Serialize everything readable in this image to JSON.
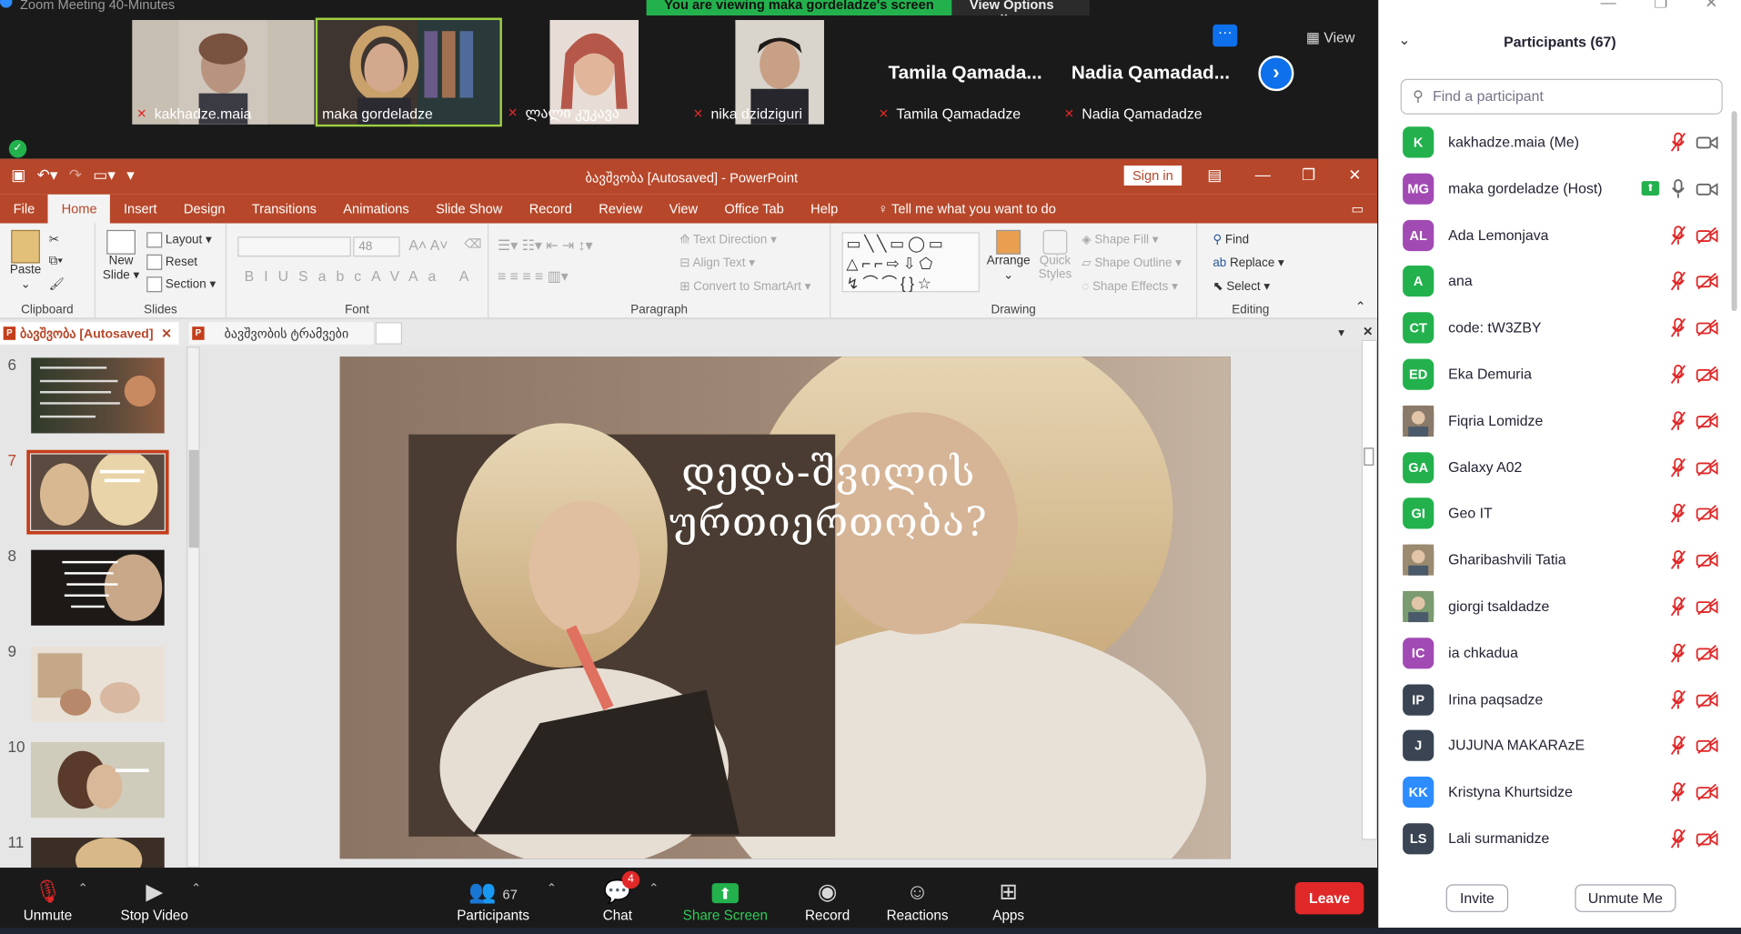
{
  "window": {
    "title": "Zoom Meeting 40-Minutes",
    "share_banner": "You are viewing maka gordeladze's screen",
    "view_options": "View Options"
  },
  "gallery": {
    "tiles": [
      {
        "name": "kakhadze.maia",
        "muted": true
      },
      {
        "name": "maka gordeladze",
        "muted": false
      },
      {
        "name": "ლალი კუკავა",
        "muted": true
      },
      {
        "name": "nika dzidziguri",
        "muted": true
      },
      {
        "name": "Tamila Qamadadze",
        "big": "Tamila Qamada...",
        "muted": true
      },
      {
        "name": "Nadia Qamadadze",
        "big": "Nadia Qamadad...",
        "muted": true
      }
    ],
    "more": "···",
    "view": "View"
  },
  "ppt": {
    "title": "ბავშვობა [Autosaved] - PowerPoint",
    "sign_in": "Sign in",
    "tabs": [
      "File",
      "Home",
      "Insert",
      "Design",
      "Transitions",
      "Animations",
      "Slide Show",
      "Record",
      "Review",
      "View",
      "Office Tab",
      "Help"
    ],
    "tell_me": "Tell me what you want to do",
    "ribbon": {
      "clipboard": {
        "label": "Clipboard",
        "paste": "Paste"
      },
      "slides": {
        "label": "Slides",
        "new_slide": "New Slide",
        "layout": "Layout",
        "reset": "Reset",
        "section": "Section"
      },
      "font": {
        "label": "Font",
        "size": "48"
      },
      "paragraph": {
        "label": "Paragraph",
        "text_direction": "Text Direction",
        "align_text": "Align Text",
        "smartart": "Convert to SmartArt"
      },
      "drawing": {
        "label": "Drawing",
        "arrange": "Arrange",
        "quick_styles": "Quick Styles",
        "shape_fill": "Shape Fill",
        "shape_outline": "Shape Outline",
        "shape_effects": "Shape Effects"
      },
      "editing": {
        "label": "Editing",
        "find": "Find",
        "replace": "Replace",
        "select": "Select"
      }
    },
    "doc_tabs": [
      "ბავშვობა [Autosaved]",
      "ბავშვობის ტრამვები"
    ],
    "thumbnails": [
      "6",
      "7",
      "8",
      "9",
      "10",
      "11"
    ],
    "slide_title": "დედა-შვილის ურთიერთობა?"
  },
  "zoom_bar": {
    "unmute": "Unmute",
    "stop_video": "Stop Video",
    "participants": "Participants",
    "participant_count": "67",
    "chat": "Chat",
    "chat_badge": "4",
    "share_screen": "Share Screen",
    "record": "Record",
    "reactions": "Reactions",
    "apps": "Apps",
    "leave": "Leave"
  },
  "panel": {
    "title": "Participants (67)",
    "search_placeholder": "Find a participant",
    "participants": [
      {
        "initials": "K",
        "name": "kakhadze.maia (Me)",
        "color": "#23b14d"
      },
      {
        "initials": "MG",
        "name": "maka gordeladze (Host)",
        "color": "#a14ab3"
      },
      {
        "initials": "AL",
        "name": "Ada Lemonjava",
        "color": "#a14ab3"
      },
      {
        "initials": "A",
        "name": "ana",
        "color": "#23b14d"
      },
      {
        "initials": "CT",
        "name": "code:  tW3ZBY",
        "color": "#23b14d"
      },
      {
        "initials": "ED",
        "name": "Eka Demuria",
        "color": "#23b14d"
      },
      {
        "initials": "",
        "name": "Fiqria Lomidze",
        "color": "#8a7a6a"
      },
      {
        "initials": "GA",
        "name": "Galaxy A02",
        "color": "#23b14d"
      },
      {
        "initials": "GI",
        "name": "Geo IT",
        "color": "#23b14d"
      },
      {
        "initials": "",
        "name": "Gharibashvili Tatia",
        "color": "#9a8a70"
      },
      {
        "initials": "",
        "name": "giorgi tsaldadze",
        "color": "#7a9a70"
      },
      {
        "initials": "IC",
        "name": "ia chkadua",
        "color": "#a14ab3"
      },
      {
        "initials": "IP",
        "name": "Irina paqsadze",
        "color": "#3a4452"
      },
      {
        "initials": "J",
        "name": "JUJUNA MAKARAzE",
        "color": "#3a4452"
      },
      {
        "initials": "KK",
        "name": "Kristyna Khurtsidze",
        "color": "#2d8cff"
      },
      {
        "initials": "LS",
        "name": "Lali surmanidze",
        "color": "#3a4452"
      }
    ],
    "invite": "Invite",
    "unmute_me": "Unmute Me"
  }
}
